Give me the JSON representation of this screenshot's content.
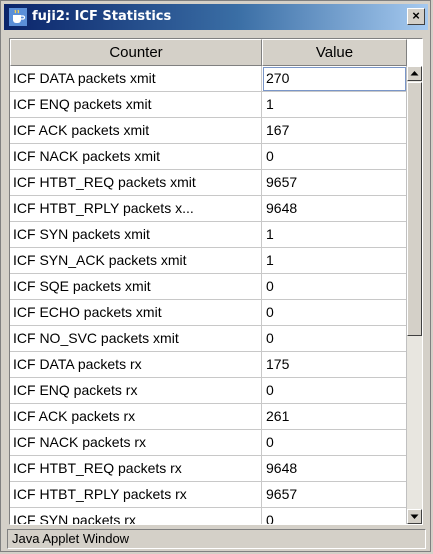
{
  "window": {
    "title": "fuji2: ICF Statistics",
    "close_glyph": "×",
    "icon": "java-coffee-cup-icon"
  },
  "table": {
    "columns": [
      "Counter",
      "Value"
    ],
    "rows": [
      {
        "counter": "ICF DATA packets xmit",
        "value": "270"
      },
      {
        "counter": "ICF ENQ packets xmit",
        "value": "1"
      },
      {
        "counter": "ICF ACK packets xmit",
        "value": "167"
      },
      {
        "counter": "ICF NACK packets xmit",
        "value": "0"
      },
      {
        "counter": "ICF HTBT_REQ packets xmit",
        "value": "9657"
      },
      {
        "counter": "ICF HTBT_RPLY packets x...",
        "value": "9648"
      },
      {
        "counter": "ICF SYN packets xmit",
        "value": "1"
      },
      {
        "counter": "ICF SYN_ACK packets xmit",
        "value": "1"
      },
      {
        "counter": "ICF SQE packets xmit",
        "value": "0"
      },
      {
        "counter": "ICF ECHO packets xmit",
        "value": "0"
      },
      {
        "counter": "ICF NO_SVC packets xmit",
        "value": "0"
      },
      {
        "counter": "ICF DATA packets rx",
        "value": "175"
      },
      {
        "counter": "ICF ENQ packets rx",
        "value": "0"
      },
      {
        "counter": "ICF ACK packets rx",
        "value": "261"
      },
      {
        "counter": "ICF NACK packets rx",
        "value": "0"
      },
      {
        "counter": "ICF HTBT_REQ packets rx",
        "value": "9648"
      },
      {
        "counter": "ICF HTBT_RPLY packets rx",
        "value": "9657"
      },
      {
        "counter": "ICF SYN packets rx",
        "value": "0"
      }
    ]
  },
  "scrollbar": {
    "up_icon": "arrow-up-icon",
    "down_icon": "arrow-down-icon"
  },
  "status": {
    "text": "Java Applet Window"
  },
  "colors": {
    "title_bar_start": "#0a246a",
    "title_bar_end": "#a6caf0",
    "window_bg": "#d4d0c8",
    "grid_line": "#c8c8c8"
  }
}
